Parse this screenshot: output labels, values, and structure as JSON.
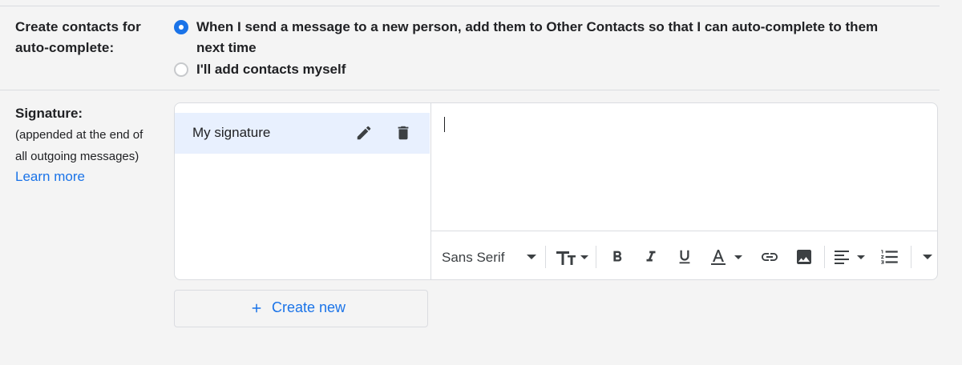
{
  "autocomplete": {
    "label_line1": "Create contacts for",
    "label_line2": "auto-complete:",
    "option_auto_line1": "When I send a message to a new person, add them to Other Contacts so that I can auto-complete to them",
    "option_auto_line2": "next time",
    "option_manual": "I'll add contacts myself",
    "selected": "auto"
  },
  "signature": {
    "label": "Signature:",
    "help_line1": "(appended at the end of",
    "help_line2": "all outgoing messages)",
    "learn_more": "Learn more",
    "items": [
      {
        "name": "My signature"
      }
    ],
    "editor_text": "",
    "toolbar": {
      "font": "Sans Serif",
      "icons": [
        "font-size-icon",
        "bold-icon",
        "italic-icon",
        "underline-icon",
        "text-color-icon",
        "link-icon",
        "image-icon",
        "align-icon",
        "numbered-list-icon",
        "more-formatting-icon"
      ]
    },
    "create_new": "Create new"
  },
  "colors": {
    "accent": "#1a73e8",
    "selected_bg": "#e8f0fe",
    "border": "#dadce0",
    "page_bg": "#f4f4f4"
  }
}
